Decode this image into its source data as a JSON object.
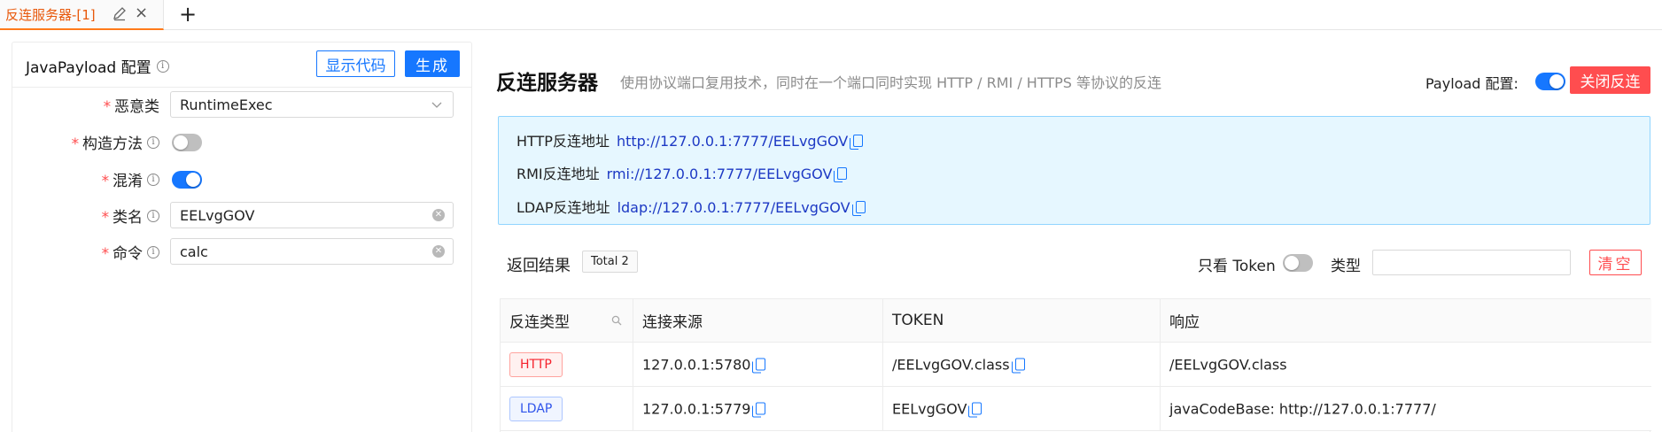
{
  "tab": {
    "title": "反连服务器-[1]",
    "close_glyph": "×",
    "add_glyph": "+"
  },
  "config": {
    "title": "JavaPayload 配置",
    "show_code_label": "显示代码",
    "generate_label": "生成",
    "fields": [
      {
        "label": "恶意类",
        "required": true,
        "info": false,
        "kind": "select",
        "value": "RuntimeExec"
      },
      {
        "label": "构造方法",
        "required": true,
        "info": true,
        "kind": "switch",
        "checked": false
      },
      {
        "label": "混淆",
        "required": true,
        "info": true,
        "kind": "switch",
        "checked": true
      },
      {
        "label": "类名",
        "required": true,
        "info": true,
        "kind": "input",
        "value": "EELvgGOV"
      },
      {
        "label": "命令",
        "required": true,
        "info": true,
        "kind": "input",
        "value": "calc"
      }
    ]
  },
  "server": {
    "title": "反连服务器",
    "subtitle": "使用协议端口复用技术，同时在一个端口同时实现 HTTP / RMI / HTTPS 等协议的反连",
    "payload_label": "Payload 配置:",
    "payload_enabled": true,
    "close_label": "关闭反连",
    "addresses": [
      {
        "label": "HTTP反连地址",
        "url": "http://127.0.0.1:7777/EELvgGOV"
      },
      {
        "label": "RMI反连地址",
        "url": "rmi://127.0.0.1:7777/EELvgGOV"
      },
      {
        "label": "LDAP反连地址",
        "url": "ldap://127.0.0.1:7777/EELvgGOV"
      }
    ]
  },
  "results": {
    "title": "返回结果",
    "total_label": "Total 2",
    "token_only_label": "只看 Token",
    "token_only_enabled": false,
    "type_label": "类型",
    "type_value": "",
    "clear_label": "清空",
    "columns": [
      "反连类型",
      "连接来源",
      "TOKEN",
      "响应"
    ],
    "rows": [
      {
        "type": "HTTP",
        "source": "127.0.0.1:5780",
        "token": "/EELvgGOV.class",
        "response": "/EELvgGOV.class"
      },
      {
        "type": "LDAP",
        "source": "127.0.0.1:5779",
        "token": "EELvgGOV",
        "response": "javaCodeBase: http://127.0.0.1:7777/"
      }
    ]
  },
  "colors": {
    "primary": "#1677ff",
    "danger": "#ff4d4f",
    "tab_active": "#e8590c",
    "info_bg": "#e6f7ff"
  }
}
